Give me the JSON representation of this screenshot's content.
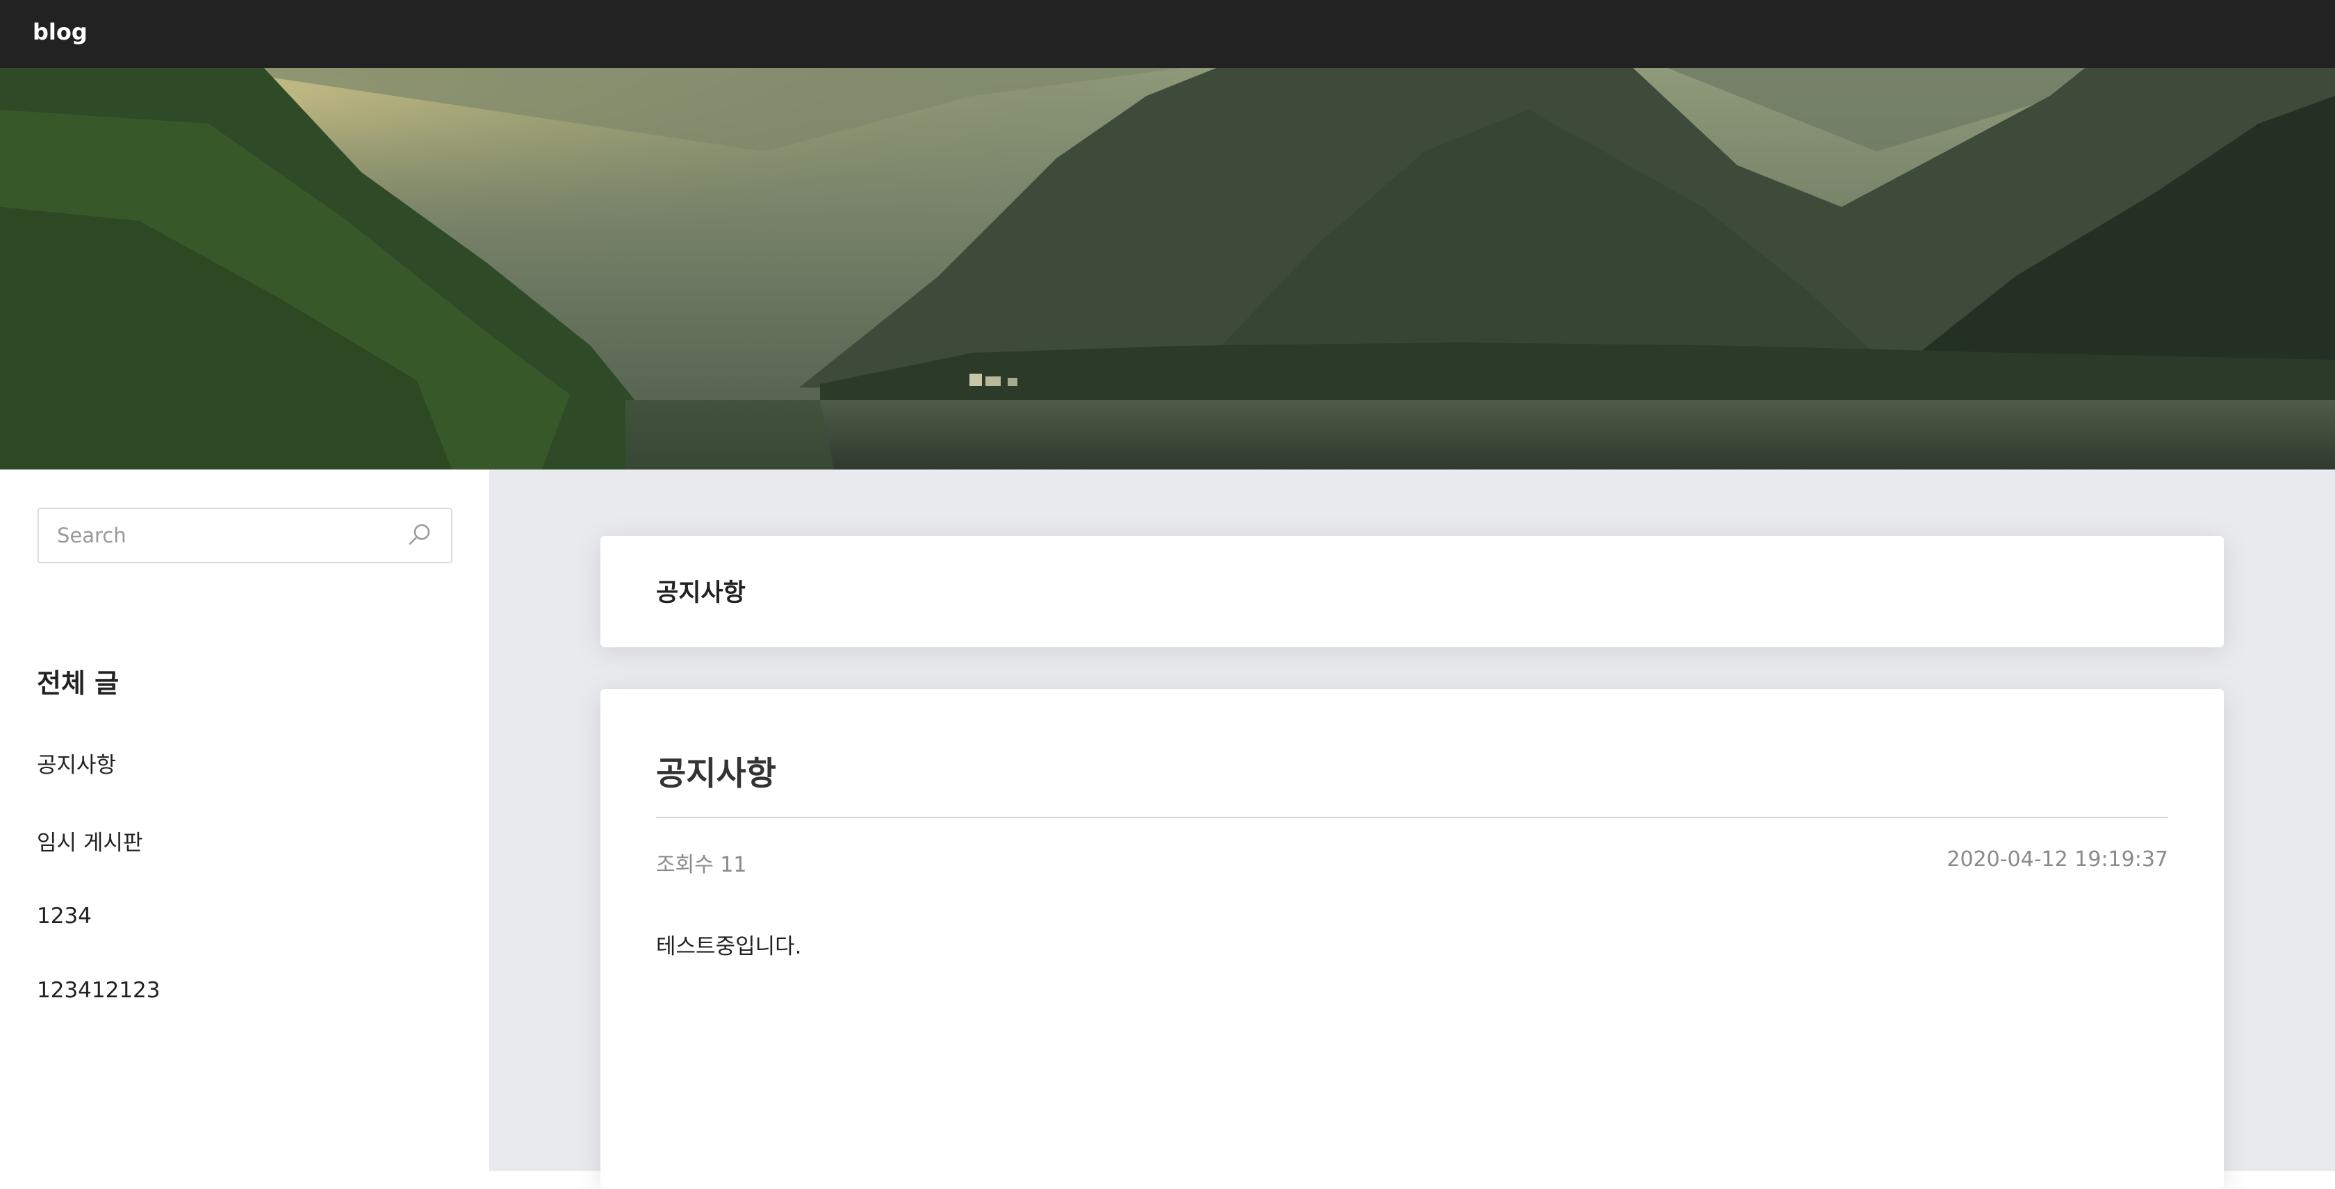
{
  "header": {
    "brand": "blog"
  },
  "search": {
    "placeholder": "Search",
    "icon": "search-icon"
  },
  "sidebar": {
    "heading": "전체 글",
    "items": [
      {
        "label": "공지사항"
      },
      {
        "label": "임시 게시판"
      },
      {
        "label": "1234"
      },
      {
        "label": "123412123"
      }
    ]
  },
  "board": {
    "title": "공지사항"
  },
  "post": {
    "title": "공지사항",
    "views": "조회수 11",
    "date": "2020-04-12 19:19:37",
    "body": "테스트중입니다."
  },
  "colors": {
    "topbar": "#222222",
    "main_background": "#e9eaee",
    "card": "#ffffff",
    "muted_text": "#8a8a8a"
  }
}
